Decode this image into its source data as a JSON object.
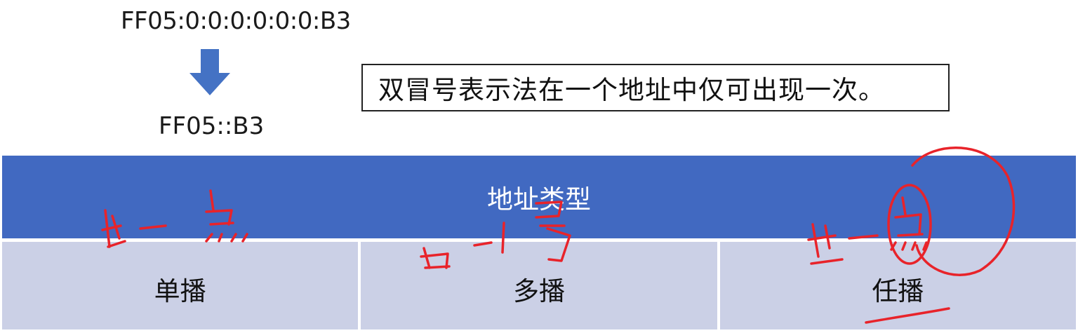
{
  "addresses": {
    "full": "FF05:0:0:0:0:0:0:B3",
    "compressed": "FF05::B3"
  },
  "note": "双冒号表示法在一个地址中仅可出现一次。",
  "table": {
    "header": "地址类型",
    "cells": [
      "单播",
      "多播",
      "任播"
    ]
  },
  "colors": {
    "header_bg": "#4169c1",
    "cell_bg": "#cbd0e6",
    "arrow": "#4472c4",
    "annotation_ink": "#e8232a"
  },
  "icons": {
    "arrow": "down-arrow-icon"
  }
}
